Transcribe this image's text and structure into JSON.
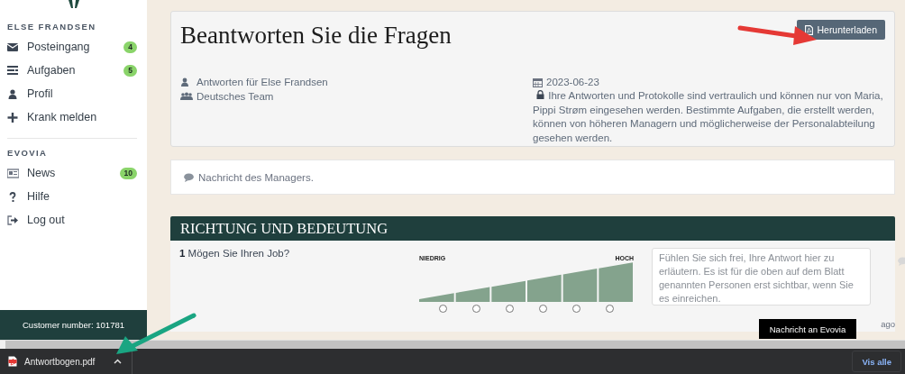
{
  "sidebar": {
    "sections": [
      {
        "heading": "ELSE FRANDSEN",
        "items": [
          {
            "label": "Posteingang",
            "badge": "4"
          },
          {
            "label": "Aufgaben",
            "badge": "5"
          },
          {
            "label": "Profil"
          },
          {
            "label": "Krank melden"
          }
        ]
      },
      {
        "heading": "EVOVIA",
        "items": [
          {
            "label": "News",
            "badge": "10"
          },
          {
            "label": "Hilfe"
          },
          {
            "label": "Log out"
          }
        ]
      }
    ],
    "customer_number": "Customer number: 101781"
  },
  "header": {
    "title": "Beantworten Sie die Fragen",
    "download_button": "Herunterladen",
    "meta_left": [
      "Antworten für Else Frandsen",
      "Deutsches Team"
    ],
    "date": "2023-06-23",
    "notice": "Ihre Antworten und Protokolle sind vertraulich und können nur von Maria, Pippi Strøm eingesehen werden. Bestimmte Aufgaben, die erstellt werden, können von höheren Managern und möglicherweise der Personalabteilung gesehen werden."
  },
  "manager_message": "Nachricht des Managers.",
  "section": {
    "title": "RICHTUNG UND BEDEUTUNG",
    "questions": [
      {
        "text": "**1** Mögen Sie Ihren Job?",
        "low_label": "NIEDRIG",
        "high_label": "HOCH",
        "options": [
          {
            "selected": false
          },
          {
            "selected": false
          },
          {
            "selected": false
          },
          {
            "selected": false
          },
          {
            "selected": false
          },
          {
            "selected": false
          }
        ],
        "comment": {
          "placeholder": "Fühlen Sie sich frei, Ihre Antwort hier zu erläutern. Es ist für die oben auf dem Blatt genannten Personen erst sichtbar, wenn Sie es einreichen."
        }
      }
    ],
    "footnote": "ago"
  },
  "message_button": "Nachricht an Evovia",
  "download_bar": {
    "file": "Antwortbogen.pdf",
    "show_all": "Vis alle"
  }
}
